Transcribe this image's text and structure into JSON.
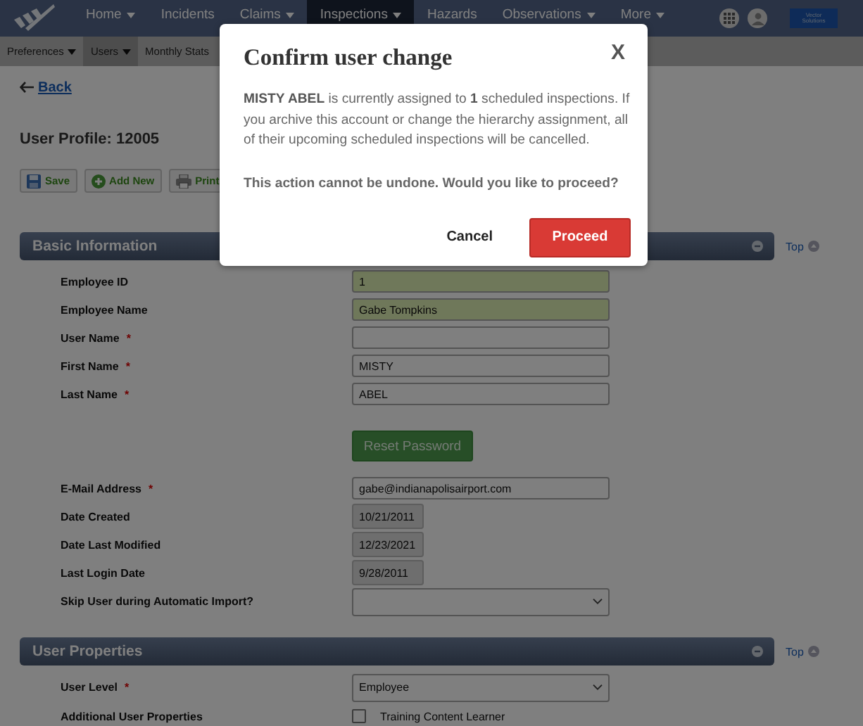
{
  "nav": {
    "logo_text": [
      "Vector",
      "Solutions"
    ],
    "items": [
      {
        "label": "Home",
        "dropdown": true,
        "selected": false
      },
      {
        "label": "Incidents",
        "dropdown": false,
        "selected": false
      },
      {
        "label": "Claims",
        "dropdown": true,
        "selected": false
      },
      {
        "label": "Inspections",
        "dropdown": true,
        "selected": true
      },
      {
        "label": "Hazards",
        "dropdown": false,
        "selected": false
      },
      {
        "label": "Observations",
        "dropdown": true,
        "selected": false
      },
      {
        "label": "More",
        "dropdown": true,
        "selected": false
      }
    ]
  },
  "subnav": {
    "items": [
      {
        "label": "Preferences",
        "dropdown": true,
        "selected": false
      },
      {
        "label": "Users",
        "dropdown": true,
        "selected": true
      },
      {
        "label": "Monthly Stats",
        "dropdown": false,
        "selected": false
      }
    ]
  },
  "back_link": "Back",
  "page_title": "User Profile: 12005",
  "toolbar": [
    {
      "kind": "save",
      "label": "Save"
    },
    {
      "kind": "add",
      "label": "Add New"
    },
    {
      "kind": "print",
      "label": "Print"
    }
  ],
  "sections": [
    {
      "title": "Basic Information",
      "top_link": "Top",
      "fields": [
        {
          "kind": "text",
          "label": "Employee ID",
          "value": "1",
          "highlighted": true
        },
        {
          "kind": "text",
          "label": "Employee Name",
          "value": "Gabe Tompkins",
          "highlighted": true
        },
        {
          "kind": "text",
          "label": "User Name",
          "required_mark": "*",
          "highlighted": false
        },
        {
          "kind": "text",
          "label": "First Name",
          "required_mark": "*",
          "value": "MISTY",
          "highlighted": false
        },
        {
          "kind": "text",
          "label": "Last Name",
          "required_mark": "*",
          "value": "ABEL",
          "highlighted": false
        },
        {
          "kind": "button",
          "value": "Reset Password"
        },
        {
          "kind": "text",
          "label": "E-Mail Address",
          "required_mark": "*",
          "value": "gabe@indianapolisairport.com",
          "highlighted": false
        },
        {
          "kind": "readonly",
          "label": "Date Created",
          "value": "10/21/2011"
        },
        {
          "kind": "readonly",
          "label": "Date Last Modified",
          "value": "12/23/2021"
        },
        {
          "kind": "readonly",
          "label": "Last Login Date",
          "value": "9/28/2011"
        },
        {
          "kind": "select",
          "label": "Skip User during Automatic Import?"
        }
      ]
    },
    {
      "title": "User Properties",
      "top_link": "Top",
      "fields": [
        {
          "kind": "select",
          "label": "User Level",
          "required_mark": "*",
          "value": "Employee"
        },
        {
          "kind": "checkbox",
          "label": "Additional User Properties",
          "value": "Training Content Learner",
          "checked": false
        }
      ]
    }
  ],
  "modal": {
    "title": "Confirm user change",
    "close": "X",
    "message": "**MISTY ABEL** is currently assigned to **1** scheduled inspections. If you archive this account or change the hierarchy assignment, all of their upcoming scheduled inspections will be cancelled.",
    "warning": "This action cannot be undone. Would you like to proceed?",
    "buttons": [
      {
        "kind": "secondary",
        "label": "Cancel"
      },
      {
        "kind": "primary",
        "label": "Proceed"
      }
    ]
  }
}
